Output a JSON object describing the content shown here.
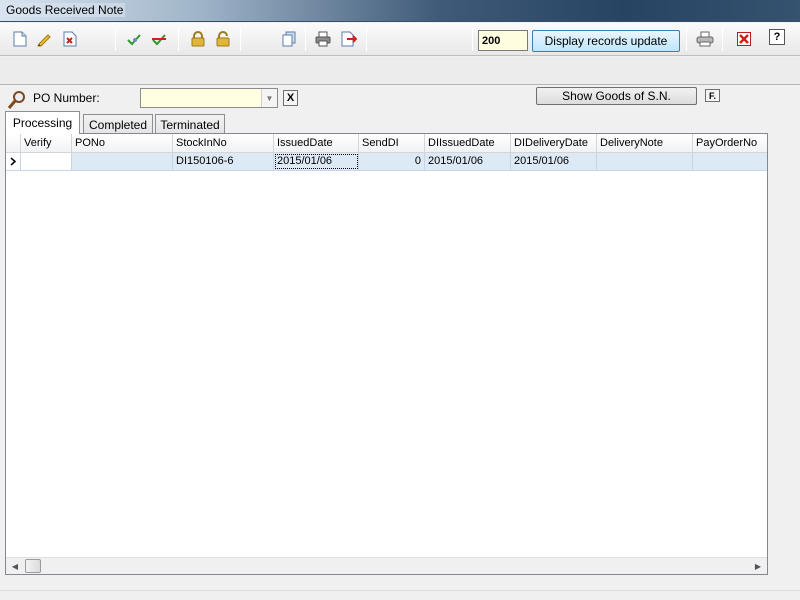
{
  "window": {
    "title": "Goods Received Note"
  },
  "toolbar": {
    "icons": [
      "new-document-icon",
      "edit-pencil-icon",
      "delete-icon",
      "approve-icon",
      "reject-icon",
      "lock-icon",
      "unlock-icon",
      "copy-icon",
      "print-icon",
      "export-icon",
      "print-preview-icon",
      "close-icon",
      "help-icon"
    ],
    "record_count": "200",
    "update_label": "Display records update",
    "help_label": "?"
  },
  "filter": {
    "po_label": "PO Number:",
    "po_value": "",
    "clear_label": "X",
    "show_goods_label": "Show Goods of S.N.",
    "f_label": "F."
  },
  "tabs": [
    "Processing",
    "Completed",
    "Terminated"
  ],
  "active_tab": "Processing",
  "grid": {
    "columns": [
      "Verify",
      "PONo",
      "StockInNo",
      "IssuedDate",
      "SendDI",
      "DIIssuedDate",
      "DIDeliveryDate",
      "DeliveryNote",
      "PayOrderNo"
    ],
    "rows": [
      {
        "Verify": "",
        "PONo": "",
        "StockInNo": "DI150106-6",
        "IssuedDate": "2015/01/06",
        "SendDI": "0",
        "DIIssuedDate": "2015/01/06",
        "DIDeliveryDate": "2015/01/06",
        "DeliveryNote": "",
        "PayOrderNo": ""
      }
    ]
  },
  "colors": {
    "selected_row": "#dde9f5",
    "input_bg": "#ffffe1",
    "button_accent": "#bee6fd"
  }
}
